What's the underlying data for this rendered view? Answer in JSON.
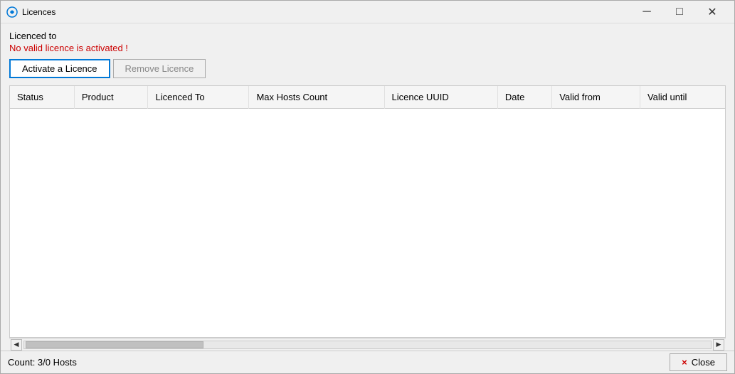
{
  "window": {
    "title": "Licences",
    "icon": "licences-icon"
  },
  "titlebar": {
    "minimize_label": "─",
    "maximize_label": "□",
    "close_label": "✕"
  },
  "content": {
    "licenced_to_label": "Licenced to",
    "no_valid_licence_text": "No valid licence is activated !",
    "activate_button_label": "Activate a Licence",
    "remove_button_label": "Remove Licence"
  },
  "table": {
    "columns": [
      {
        "key": "status",
        "label": "Status"
      },
      {
        "key": "product",
        "label": "Product"
      },
      {
        "key": "licenced_to",
        "label": "Licenced To"
      },
      {
        "key": "max_hosts_count",
        "label": "Max Hosts Count"
      },
      {
        "key": "licence_uuid",
        "label": "Licence UUID"
      },
      {
        "key": "date",
        "label": "Date"
      },
      {
        "key": "valid_from",
        "label": "Valid from"
      },
      {
        "key": "valid_until",
        "label": "Valid until"
      }
    ],
    "rows": []
  },
  "footer": {
    "count_label": "Count:  3/0 Hosts",
    "close_button_label": "Close",
    "close_icon": "×"
  }
}
